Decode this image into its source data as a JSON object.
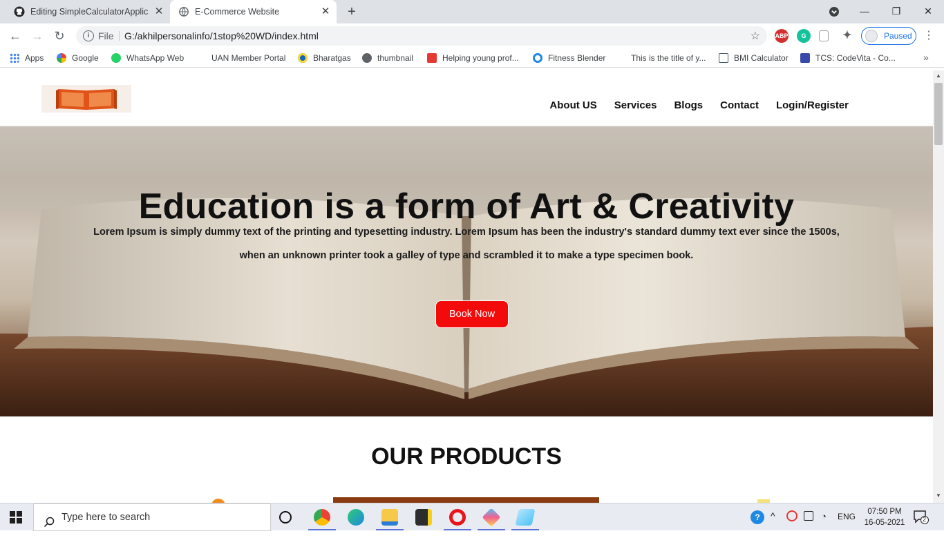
{
  "browser": {
    "tabs": [
      {
        "title": "Editing SimpleCalculatorApplicati",
        "favicon": "github-icon",
        "active": false
      },
      {
        "title": "E-Commerce Website",
        "favicon": "globe-icon",
        "active": true
      }
    ],
    "address": {
      "scheme": "File",
      "url": "G:/akhilpersonalinfo/1stop%20WD/index.html"
    },
    "profile_label": "Paused",
    "bookmarks": [
      {
        "label": "Apps",
        "icon": "apps-grid-icon",
        "color": "#4285f4"
      },
      {
        "label": "Google",
        "icon": "google-icon",
        "color": "#ea4335"
      },
      {
        "label": "WhatsApp Web",
        "icon": "whatsapp-icon",
        "color": "#25d366"
      },
      {
        "label": "UAN Member Portal",
        "icon": "blank-page-icon",
        "color": "#ffffff"
      },
      {
        "label": "Bharatgas",
        "icon": "bharatgas-icon",
        "color": "#1565c0"
      },
      {
        "label": "thumbnail",
        "icon": "globe-icon",
        "color": "#5f6368"
      },
      {
        "label": "Helping young prof...",
        "icon": "ux-icon",
        "color": "#e53935"
      },
      {
        "label": "Fitness Blender",
        "icon": "fitness-blender-icon",
        "color": "#1e88e5"
      },
      {
        "label": "This is the title of y...",
        "icon": "blank-page-icon",
        "color": "#ffffff"
      },
      {
        "label": "BMI Calculator",
        "icon": "calculator-icon",
        "color": "#455a64"
      },
      {
        "label": "TCS: CodeVita - Co...",
        "icon": "tcs-icon",
        "color": "#3949ab"
      }
    ]
  },
  "site": {
    "nav": [
      "About US",
      "Services",
      "Blogs",
      "Contact",
      "Login/Register"
    ],
    "hero": {
      "title": "Education is a form of Art & Creativity",
      "text": "Lorem Ipsum is simply dummy text of the printing and typesetting industry. Lorem Ipsum has been the industry's standard dummy text ever since the 1500s, when an unknown printer took a galley of type and scrambled it to make a type specimen book.",
      "button": "Book Now"
    },
    "products_title": "OUR PRODUCTS",
    "colors": {
      "accent": "#f30a0a",
      "logo": "#e0541a"
    }
  },
  "taskbar": {
    "search_placeholder": "Type here to search",
    "language": "ENG",
    "time": "07:50 PM",
    "date": "16-05-2021",
    "notification_count": "2"
  }
}
